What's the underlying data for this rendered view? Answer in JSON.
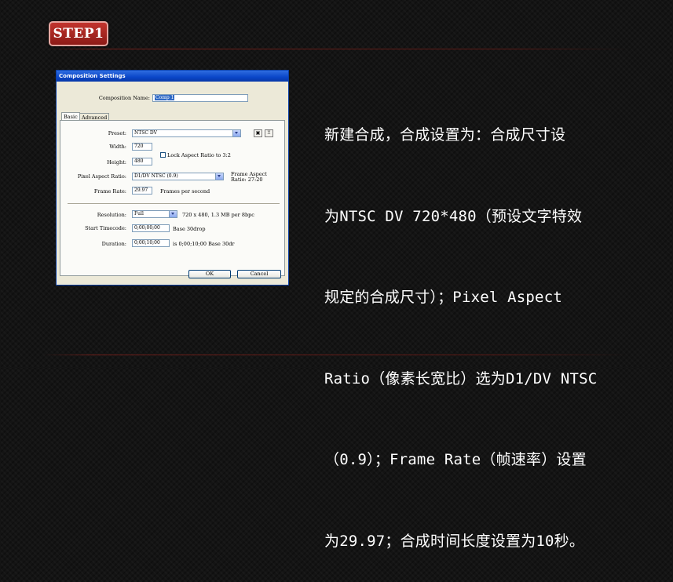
{
  "step_badge": "STEP1",
  "description_lines": [
    "新建合成，合成设置为：合成尺寸设",
    "为NTSC DV 720*480（预设文字特效",
    "规定的合成尺寸）；Pixel Aspect",
    "Ratio（像素长宽比）选为D1/DV NTSC",
    "（0.9）；Frame Rate（帧速率）设置",
    "为29.97；合成时间长度设置为10秒。"
  ],
  "dialog": {
    "title": "Composition Settings",
    "comp_name_label": "Composition Name:",
    "comp_name_value": "Comp 1",
    "tabs": [
      "Basic",
      "Advanced"
    ],
    "preset_label": "Preset:",
    "preset_value": "NTSC DV",
    "save_icon": "floppy-icon",
    "delete_icon": "trash-icon",
    "width_label": "Width:",
    "width_value": "720",
    "height_label": "Height:",
    "height_value": "480",
    "lock_aspect_label": "Lock Aspect Ratio to 3:2",
    "lock_aspect_checked": false,
    "par_label": "Pixel Aspect Ratio:",
    "par_value": "D1/DV NTSC (0.9)",
    "frame_aspect_label": "Frame Aspect",
    "frame_aspect_value": "Ratio: 27:20",
    "frame_rate_label": "Frame Rate:",
    "frame_rate_value": "29.97",
    "frame_rate_suffix": "Frames per second",
    "resolution_label": "Resolution:",
    "resolution_value": "Full",
    "resolution_info": "720 x 480, 1.3 MB per 8bpc",
    "start_tc_label": "Start Timecode:",
    "start_tc_value": "0;00;00;00",
    "start_tc_suffix": "Base 30drop",
    "duration_label": "Duration:",
    "duration_value": "0;00;10;00",
    "duration_suffix": "is 0;00;10;00  Base 30dr",
    "ok_label": "OK",
    "cancel_label": "Cancel"
  }
}
